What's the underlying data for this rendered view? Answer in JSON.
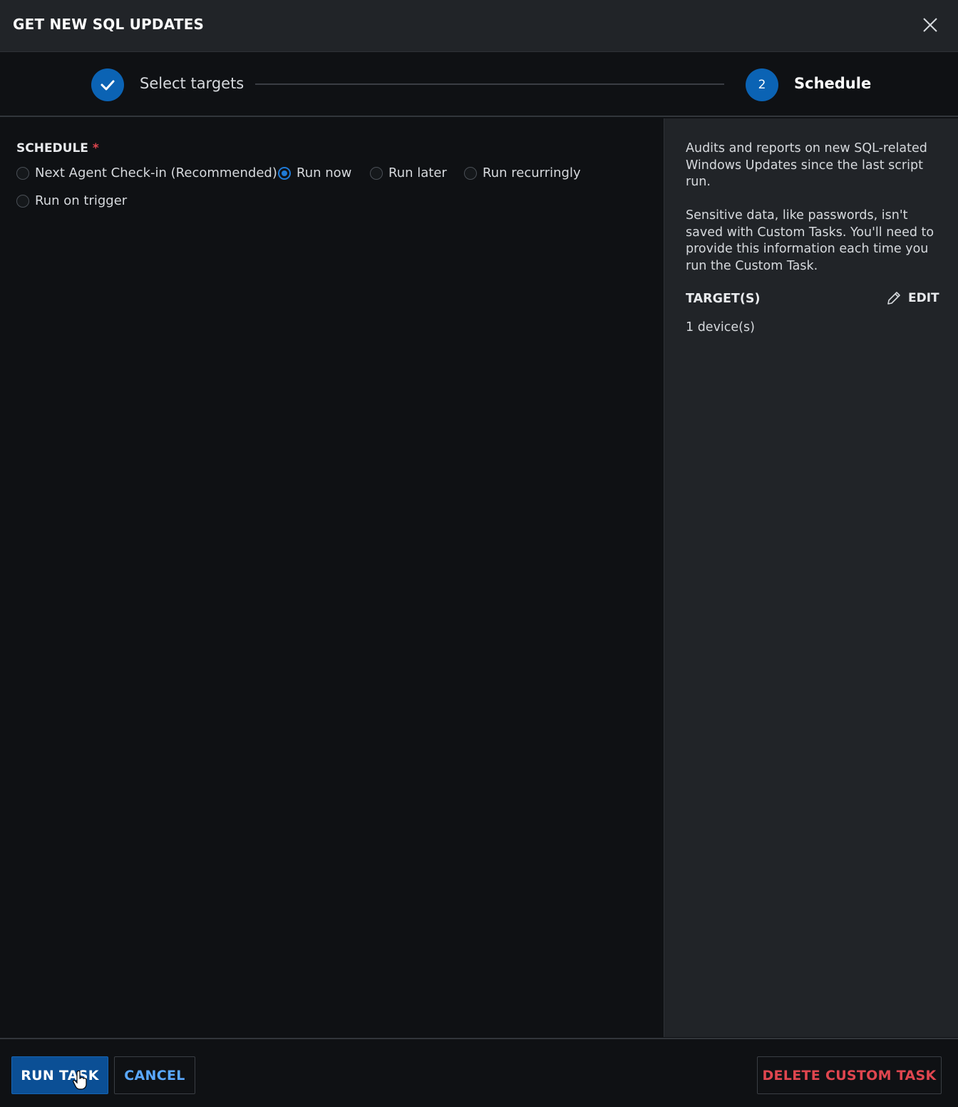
{
  "dialog": {
    "title": "GET NEW SQL UPDATES",
    "close_icon": "close-icon"
  },
  "stepper": {
    "steps": [
      {
        "label": "Select targets",
        "state": "completed",
        "icon": "check-icon"
      },
      {
        "number": "2",
        "label": "Schedule",
        "state": "active"
      }
    ]
  },
  "schedule": {
    "label": "SCHEDULE",
    "required_marker": "*",
    "options": [
      {
        "label": "Next Agent Check-in (Recommended)",
        "checked": false
      },
      {
        "label": "Run now",
        "checked": true
      },
      {
        "label": "Run later",
        "checked": false
      },
      {
        "label": "Run recurringly",
        "checked": false
      },
      {
        "label": "Run on trigger",
        "checked": false
      }
    ]
  },
  "side_panel": {
    "description": "Audits and reports on new SQL-related Windows Updates since the last script run.",
    "sensitive_note": "Sensitive data, like passwords, isn't saved with Custom Tasks. You'll need to provide this information each time you run the Custom Task.",
    "targets_label": "TARGET(S)",
    "edit_label": "EDIT",
    "device_count": "1 device(s)"
  },
  "footer": {
    "run_task_label": "RUN TASK",
    "cancel_label": "CANCEL",
    "delete_label": "DELETE CUSTOM TASK"
  },
  "colors": {
    "accent": "#0b63b4",
    "danger": "#e0464f",
    "link": "#5aa8ff",
    "header_bg": "#212428",
    "body_bg": "#0f1114"
  }
}
